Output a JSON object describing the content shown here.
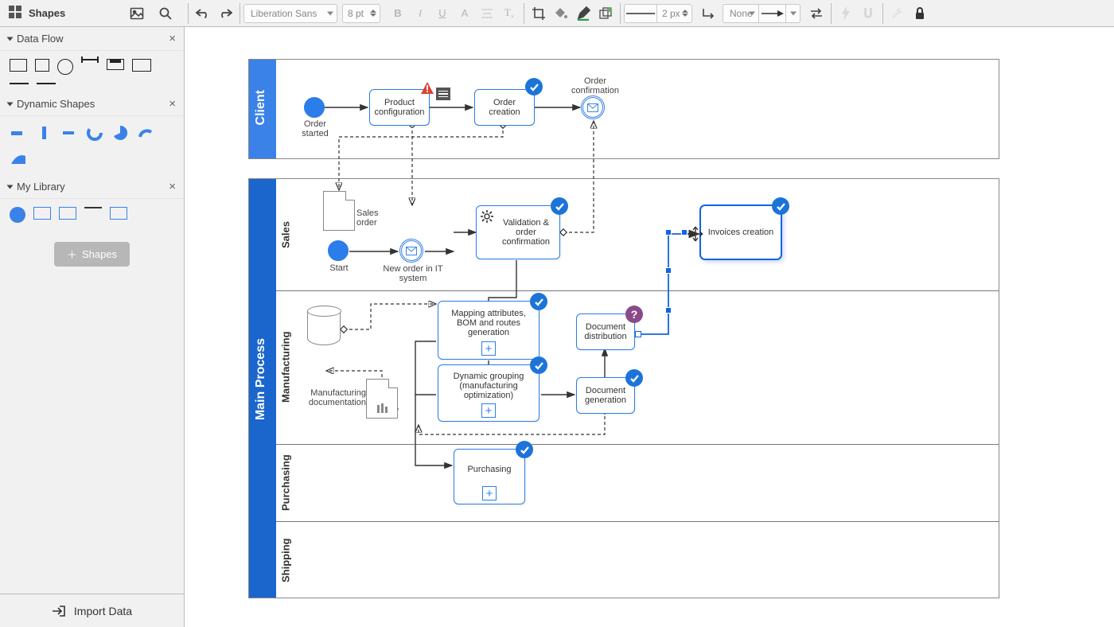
{
  "app": {
    "title": "Shapes"
  },
  "toolbar": {
    "font": "Liberation Sans",
    "font_size": "8 pt",
    "stroke_width": "2 px",
    "fill": "None"
  },
  "sidebar": {
    "sections": {
      "dataflow": "Data Flow",
      "dynamic": "Dynamic Shapes",
      "mylib": "My Library"
    },
    "shapes_btn": "Shapes",
    "import": "Import Data"
  },
  "diagram": {
    "pools": {
      "client": "Client",
      "main": "Main Process"
    },
    "lanes": {
      "sales": "Sales",
      "manufacturing": "Manufacturing",
      "purchasing": "Purchasing",
      "shipping": "Shipping"
    },
    "events": {
      "order_started": "Order\nstarted",
      "order_confirmation": "Order\nconfirmation",
      "start": "Start",
      "new_order": "New order in IT\nsystem"
    },
    "tasks": {
      "product_config": "Product configuration",
      "order_creation": "Order creation",
      "validation": "Validation & order confirmation",
      "invoices": "Invoices creation",
      "mapping": "Mapping attributes, BOM and routes generation",
      "dyn_group": "Dynamic grouping (manufacturing optimization)",
      "doc_gen": "Document generation",
      "doc_dist": "Document distribution",
      "purchasing": "Purchasing"
    },
    "data": {
      "sales_order": "Sales\norder",
      "mfg_doc": "Manufacturing\ndocumentation"
    }
  }
}
